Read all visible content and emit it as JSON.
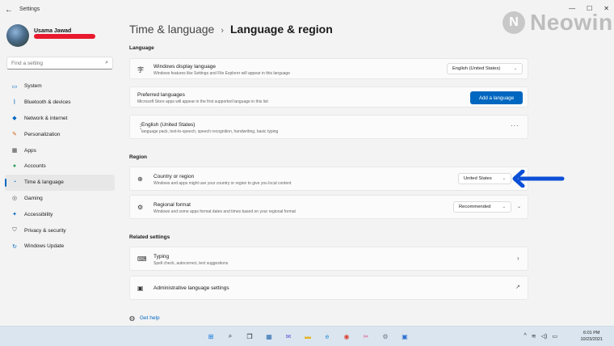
{
  "window": {
    "title": "Settings",
    "back_glyph": "←",
    "minimize": "—",
    "maximize": "☐",
    "close": "✕"
  },
  "watermark": {
    "text": "Neowin",
    "logo_glyph": "N"
  },
  "profile": {
    "name": "Usama Jawad"
  },
  "search": {
    "placeholder": "Find a setting",
    "icon": "search-icon"
  },
  "sidebar": {
    "items": [
      {
        "label": "System",
        "icon": "monitor-icon",
        "color": "#0067c0"
      },
      {
        "label": "Bluetooth & devices",
        "icon": "bluetooth-icon",
        "color": "#0067c0"
      },
      {
        "label": "Network & internet",
        "icon": "wifi-icon",
        "color": "#0067c0"
      },
      {
        "label": "Personalization",
        "icon": "paintbrush-icon",
        "color": "#d1641a"
      },
      {
        "label": "Apps",
        "icon": "apps-icon",
        "color": "#444444"
      },
      {
        "label": "Accounts",
        "icon": "person-icon",
        "color": "#2aa05b"
      },
      {
        "label": "Time & language",
        "icon": "globe-clock-icon",
        "color": "#0067c0",
        "active": true
      },
      {
        "label": "Gaming",
        "icon": "gamepad-icon",
        "color": "#555555"
      },
      {
        "label": "Accessibility",
        "icon": "accessibility-icon",
        "color": "#0067c0"
      },
      {
        "label": "Privacy & security",
        "icon": "shield-icon",
        "color": "#555555"
      },
      {
        "label": "Windows Update",
        "icon": "update-icon",
        "color": "#0067c0"
      }
    ]
  },
  "header": {
    "crumb": "Time & language",
    "separator": "›",
    "current": "Language & region"
  },
  "sections": {
    "language": "Language",
    "region": "Region",
    "related": "Related settings"
  },
  "display_language": {
    "title": "Windows display language",
    "description": "Windows features like Settings and File Explorer will appear in this language",
    "value": "English (United States)"
  },
  "preferred_languages": {
    "title": "Preferred languages",
    "description": "Microsoft Store apps will appear in the first supported language in this list",
    "button": "Add a language"
  },
  "language_item": {
    "title": "English (United States)",
    "description": "language pack, text-to-speech, speech recognition, handwriting, basic typing",
    "more": "···"
  },
  "country": {
    "title": "Country or region",
    "description": "Windows and apps might use your country or region to give you local content",
    "value": "United States"
  },
  "regional_format": {
    "title": "Regional format",
    "description": "Windows and some apps format dates and times based on your regional format",
    "value": "Recommended"
  },
  "typing": {
    "title": "Typing",
    "description": "Spell check, autocorrect, text suggestions"
  },
  "admin_language": {
    "title": "Administrative language settings"
  },
  "get_help": {
    "label": "Get help"
  },
  "annotation_arrow": {
    "color": "#0b4fd6"
  },
  "taskbar": {
    "icons": [
      {
        "name": "start-icon",
        "glyph": "⊞",
        "color": "#0a74da"
      },
      {
        "name": "search-taskbar-icon",
        "glyph": "⌕",
        "color": "#1a1a1a"
      },
      {
        "name": "task-view-icon",
        "glyph": "❐",
        "color": "#1a1a1a"
      },
      {
        "name": "widgets-icon",
        "glyph": "▦",
        "color": "#2b6cb0"
      },
      {
        "name": "chat-icon",
        "glyph": "✉",
        "color": "#6b5bd2"
      },
      {
        "name": "file-explorer-icon",
        "glyph": "▬",
        "color": "#e6b422"
      },
      {
        "name": "edge-icon",
        "glyph": "e",
        "color": "#1a8ad6"
      },
      {
        "name": "chrome-icon",
        "glyph": "◉",
        "color": "#db4437"
      },
      {
        "name": "snipping-icon",
        "glyph": "✂",
        "color": "#e05b8a"
      },
      {
        "name": "settings-icon",
        "glyph": "⚙",
        "color": "#6b7a89"
      },
      {
        "name": "app-icon",
        "glyph": "▣",
        "color": "#2f6fd0"
      }
    ],
    "tray": {
      "chevron": "^",
      "wifi": "≋",
      "volume": "◁)",
      "battery": "▭"
    },
    "time": "6:01 PM",
    "date": "10/23/2021"
  }
}
